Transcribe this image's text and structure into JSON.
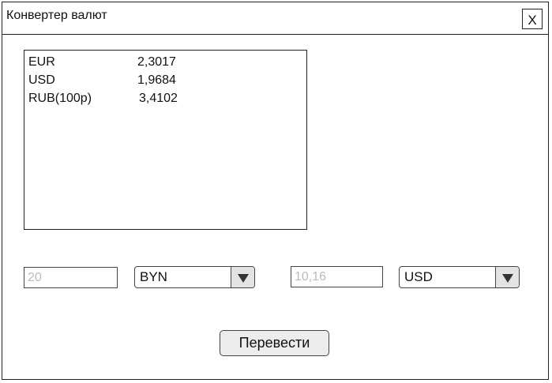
{
  "window": {
    "title": "Конвертер валют",
    "close_label": "X"
  },
  "rates": [
    {
      "code": "EUR",
      "value": "2,3017"
    },
    {
      "code": "USD",
      "value": "1,9684"
    },
    {
      "code": "RUB(100р)",
      "value": "3,4102"
    }
  ],
  "from": {
    "amount_placeholder": "20",
    "currency": "BYN"
  },
  "to": {
    "amount_placeholder": "10,16",
    "currency": "USD"
  },
  "convert_label": "Перевести",
  "icons": {
    "dropdown": "triangle-down-icon"
  }
}
